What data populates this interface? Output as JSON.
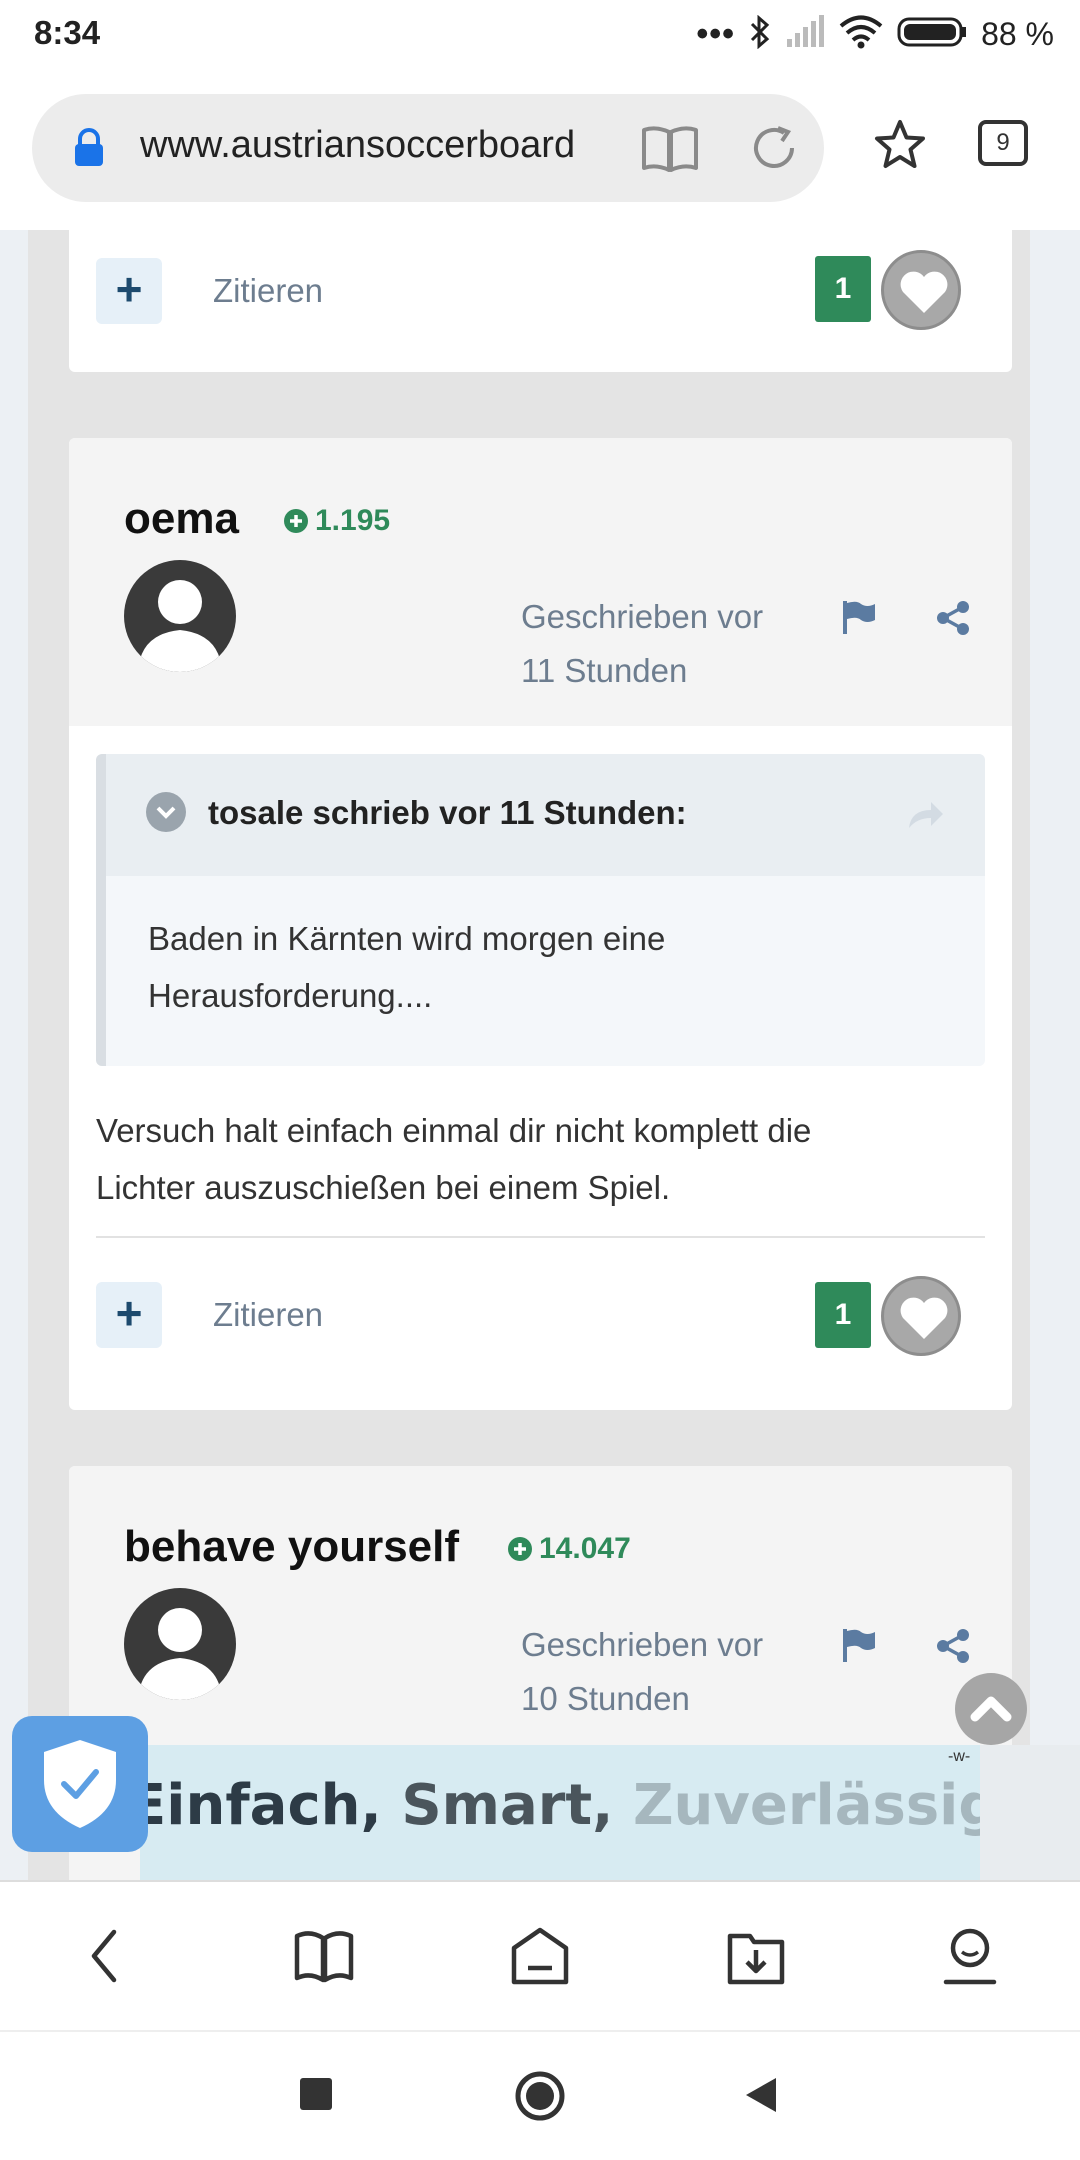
{
  "status": {
    "time": "8:34",
    "dots": "•••",
    "battery": "88 %"
  },
  "browser": {
    "url": "www.austriansoccerboard",
    "tab_count": "9"
  },
  "post_prev": {
    "quote_label": "Zitieren",
    "reaction_count": "1"
  },
  "post1": {
    "username": "oema",
    "reputation": "1.195",
    "posted_line1": "Geschrieben vor",
    "posted_line2": "11 Stunden",
    "quote_header": "tosale schrieb vor 11 Stunden:",
    "quote_line1": "Baden in Kärnten wird morgen eine",
    "quote_line2": "Herausforderung....",
    "text_line1": "Versuch halt einfach einmal dir nicht komplett die",
    "text_line2": "Lichter auszuschießen bei einem Spiel.",
    "quote_label": "Zitieren",
    "reaction_count": "1"
  },
  "post2": {
    "username": "behave yourself",
    "reputation": "14.047",
    "posted_line1": "Geschrieben vor",
    "posted_line2": "10 Stunden"
  },
  "ad": {
    "word1": "Einfach,",
    "word2": "Smart,",
    "word3": "Zuverlässig.",
    "mark": "-w-"
  },
  "colors": {
    "accent_green": "#2f8a5a",
    "link_gray": "#6d7d8f",
    "shield_blue": "#5d9fe3"
  }
}
